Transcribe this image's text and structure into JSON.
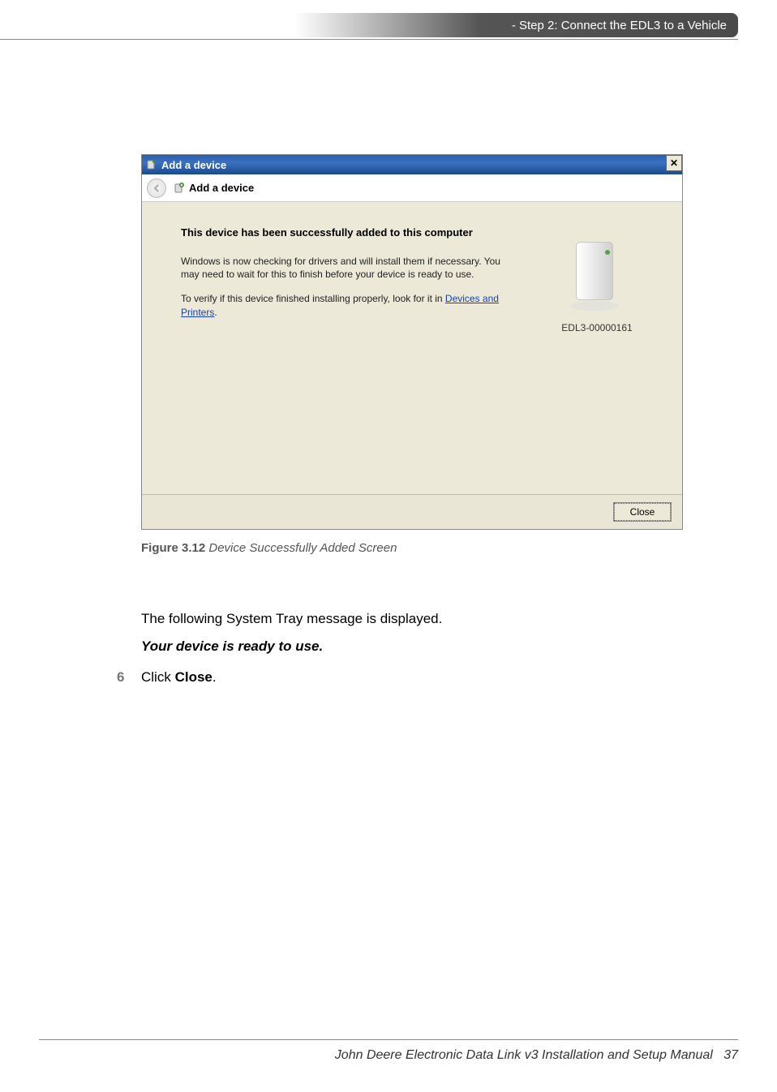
{
  "header": {
    "breadcrumb": " - Step 2: Connect the EDL3 to a Vehicle"
  },
  "dialog": {
    "titlebar_text": "Add a device",
    "nav_title": "Add a device",
    "heading": "This device has been successfully added to this computer",
    "para1": "Windows is now checking for drivers and will install them if necessary. You may need to wait for this to finish before your device is ready to use.",
    "para2_prefix": "To verify if this device finished installing properly, look for it in ",
    "para2_link": "Devices and Printers",
    "para2_suffix": ".",
    "device_label": "EDL3-00000161",
    "close_button": "Close"
  },
  "caption": {
    "fig_label": "Figure 3.12",
    "fig_title": " Device Successfully Added Screen"
  },
  "body": {
    "line1": "The following System Tray message is displayed.",
    "line2": "Your device is ready to use.",
    "step_num": "6",
    "step_text_prefix": "Click ",
    "step_text_bold": "Close",
    "step_text_suffix": "."
  },
  "footer": {
    "manual_title": "John Deere Electronic Data Link v3 Installation and Setup Manual",
    "page_num": "37"
  }
}
